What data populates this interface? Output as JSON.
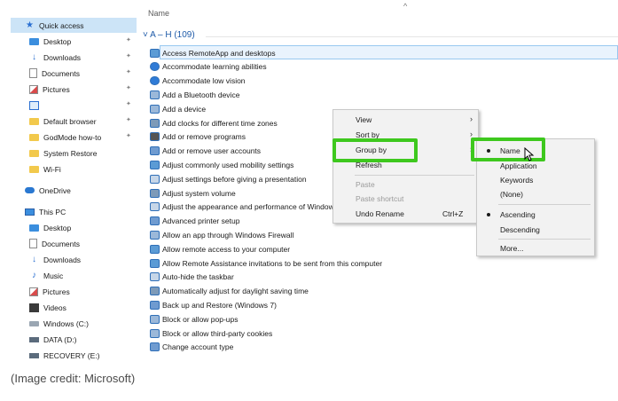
{
  "sidebar": {
    "items": [
      {
        "label": "Quick access",
        "icon": "star-icon",
        "selected": true,
        "pinned": false
      },
      {
        "label": "Desktop",
        "icon": "desktop-folder-icon",
        "pinned": true
      },
      {
        "label": "Downloads",
        "icon": "download-icon",
        "pinned": true
      },
      {
        "label": "Documents",
        "icon": "documents-icon",
        "pinned": true
      },
      {
        "label": "Pictures",
        "icon": "pictures-icon",
        "pinned": true
      },
      {
        "label": "",
        "icon": "monitor-icon",
        "pinned": true
      },
      {
        "label": "Default browser",
        "icon": "folder-icon",
        "pinned": true
      },
      {
        "label": "GodMode how-to",
        "icon": "folder-icon",
        "pinned": true
      },
      {
        "label": "System Restore",
        "icon": "folder-icon",
        "pinned": false
      },
      {
        "label": "Wi-Fi",
        "icon": "folder-icon",
        "pinned": false
      },
      {
        "label": "OneDrive",
        "icon": "cloud-icon",
        "pinned": false
      },
      {
        "label": "This PC",
        "icon": "pc-icon",
        "pinned": false
      },
      {
        "label": "Desktop",
        "icon": "desktop-folder-icon",
        "pinned": false
      },
      {
        "label": "Documents",
        "icon": "documents-icon",
        "pinned": false
      },
      {
        "label": "Downloads",
        "icon": "download-icon",
        "pinned": false
      },
      {
        "label": "Music",
        "icon": "music-icon",
        "pinned": false
      },
      {
        "label": "Pictures",
        "icon": "pictures-icon",
        "pinned": false
      },
      {
        "label": "Videos",
        "icon": "videos-icon",
        "pinned": false
      },
      {
        "label": "Windows (C:)",
        "icon": "drive-icon",
        "pinned": false
      },
      {
        "label": "DATA (D:)",
        "icon": "drive-icon",
        "pinned": false
      },
      {
        "label": "RECOVERY (E:)",
        "icon": "drive-icon",
        "pinned": false
      }
    ]
  },
  "list": {
    "column_header": "Name",
    "sort_indicator": "^",
    "group_header": "A – H (109)",
    "items": [
      "Access RemoteApp and desktops",
      "Accommodate learning abilities",
      "Accommodate low vision",
      "Add a Bluetooth device",
      "Add a device",
      "Add clocks for different time zones",
      "Add or remove programs",
      "Add or remove user accounts",
      "Adjust commonly used mobility settings",
      "Adjust settings before giving a presentation",
      "Adjust system volume",
      "Adjust the appearance and performance of Windows",
      "Advanced printer setup",
      "Allow an app through Windows Firewall",
      "Allow remote access to your computer",
      "Allow Remote Assistance invitations to be sent from this computer",
      "Auto-hide the taskbar",
      "Automatically adjust for daylight saving time",
      "Back up and Restore (Windows 7)",
      "Block or allow pop-ups",
      "Block or allow third-party cookies",
      "Change account type"
    ]
  },
  "context_menu": {
    "view": "View",
    "sort_by": "Sort by",
    "group_by": "Group by",
    "refresh": "Refresh",
    "paste": "Paste",
    "paste_shortcut": "Paste shortcut",
    "undo_rename": "Undo Rename",
    "undo_shortcut": "Ctrl+Z",
    "submenu_arrow": "›"
  },
  "submenu": {
    "name": "Name",
    "application": "Application",
    "keywords": "Keywords",
    "none": "(None)",
    "ascending": "Ascending",
    "descending": "Descending",
    "more": "More..."
  },
  "caption": "(Image credit: Microsoft)",
  "colors": {
    "highlight": "#3ec81e",
    "selection": "#cce4f7",
    "group_header": "#1e5aa8",
    "accent": "#2a6fd1"
  }
}
